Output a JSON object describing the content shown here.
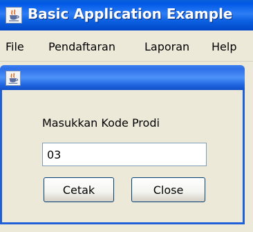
{
  "window": {
    "title": "Basic Application Example",
    "icon": "java-cup-icon"
  },
  "menubar": {
    "items": [
      "File",
      "Pendaftaran",
      "Laporan",
      "Help"
    ]
  },
  "dialog": {
    "icon": "java-cup-icon",
    "prompt_label": "Masukkan Kode Prodi",
    "code_value": "03",
    "buttons": {
      "print_label": "Cetak",
      "close_label": "Close"
    }
  }
}
